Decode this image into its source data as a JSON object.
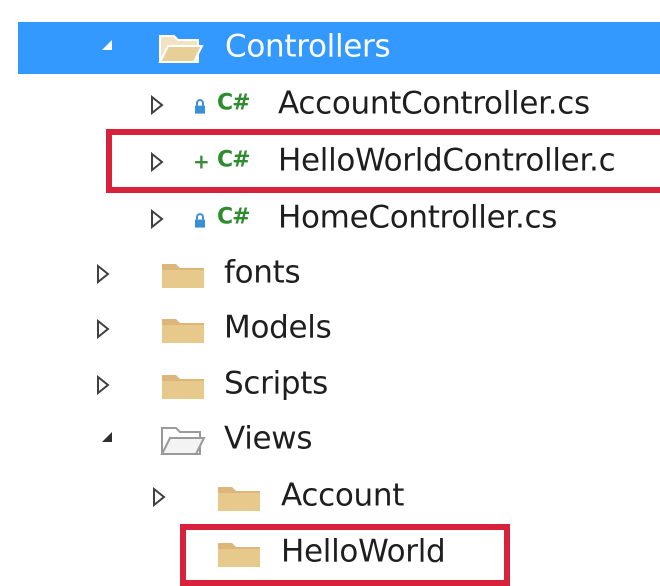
{
  "tree": {
    "controllers": {
      "label": "Controllers",
      "expanded": true,
      "selected": true
    },
    "account_controller": {
      "label": "AccountController.cs",
      "badge": "C#",
      "status_icon": "lock-icon"
    },
    "helloworld_controller": {
      "label": "HelloWorldController.c",
      "badge": "C#",
      "status_icon": "plus-icon",
      "status_text": "+"
    },
    "home_controller": {
      "label": "HomeController.cs",
      "badge": "C#",
      "status_icon": "lock-icon"
    },
    "fonts": {
      "label": "fonts",
      "expanded": false
    },
    "models": {
      "label": "Models",
      "expanded": false
    },
    "scripts": {
      "label": "Scripts",
      "expanded": false
    },
    "views": {
      "label": "Views",
      "expanded": true
    },
    "account_folder": {
      "label": "Account",
      "expanded": false
    },
    "helloworld_folder": {
      "label": "HelloWorld"
    }
  },
  "colors": {
    "selection": "#3399ff",
    "highlight_box": "#d8213a",
    "csharp_badge": "#2e8b2e",
    "folder": "#dcb67a",
    "lock": "#3b8fd4"
  }
}
